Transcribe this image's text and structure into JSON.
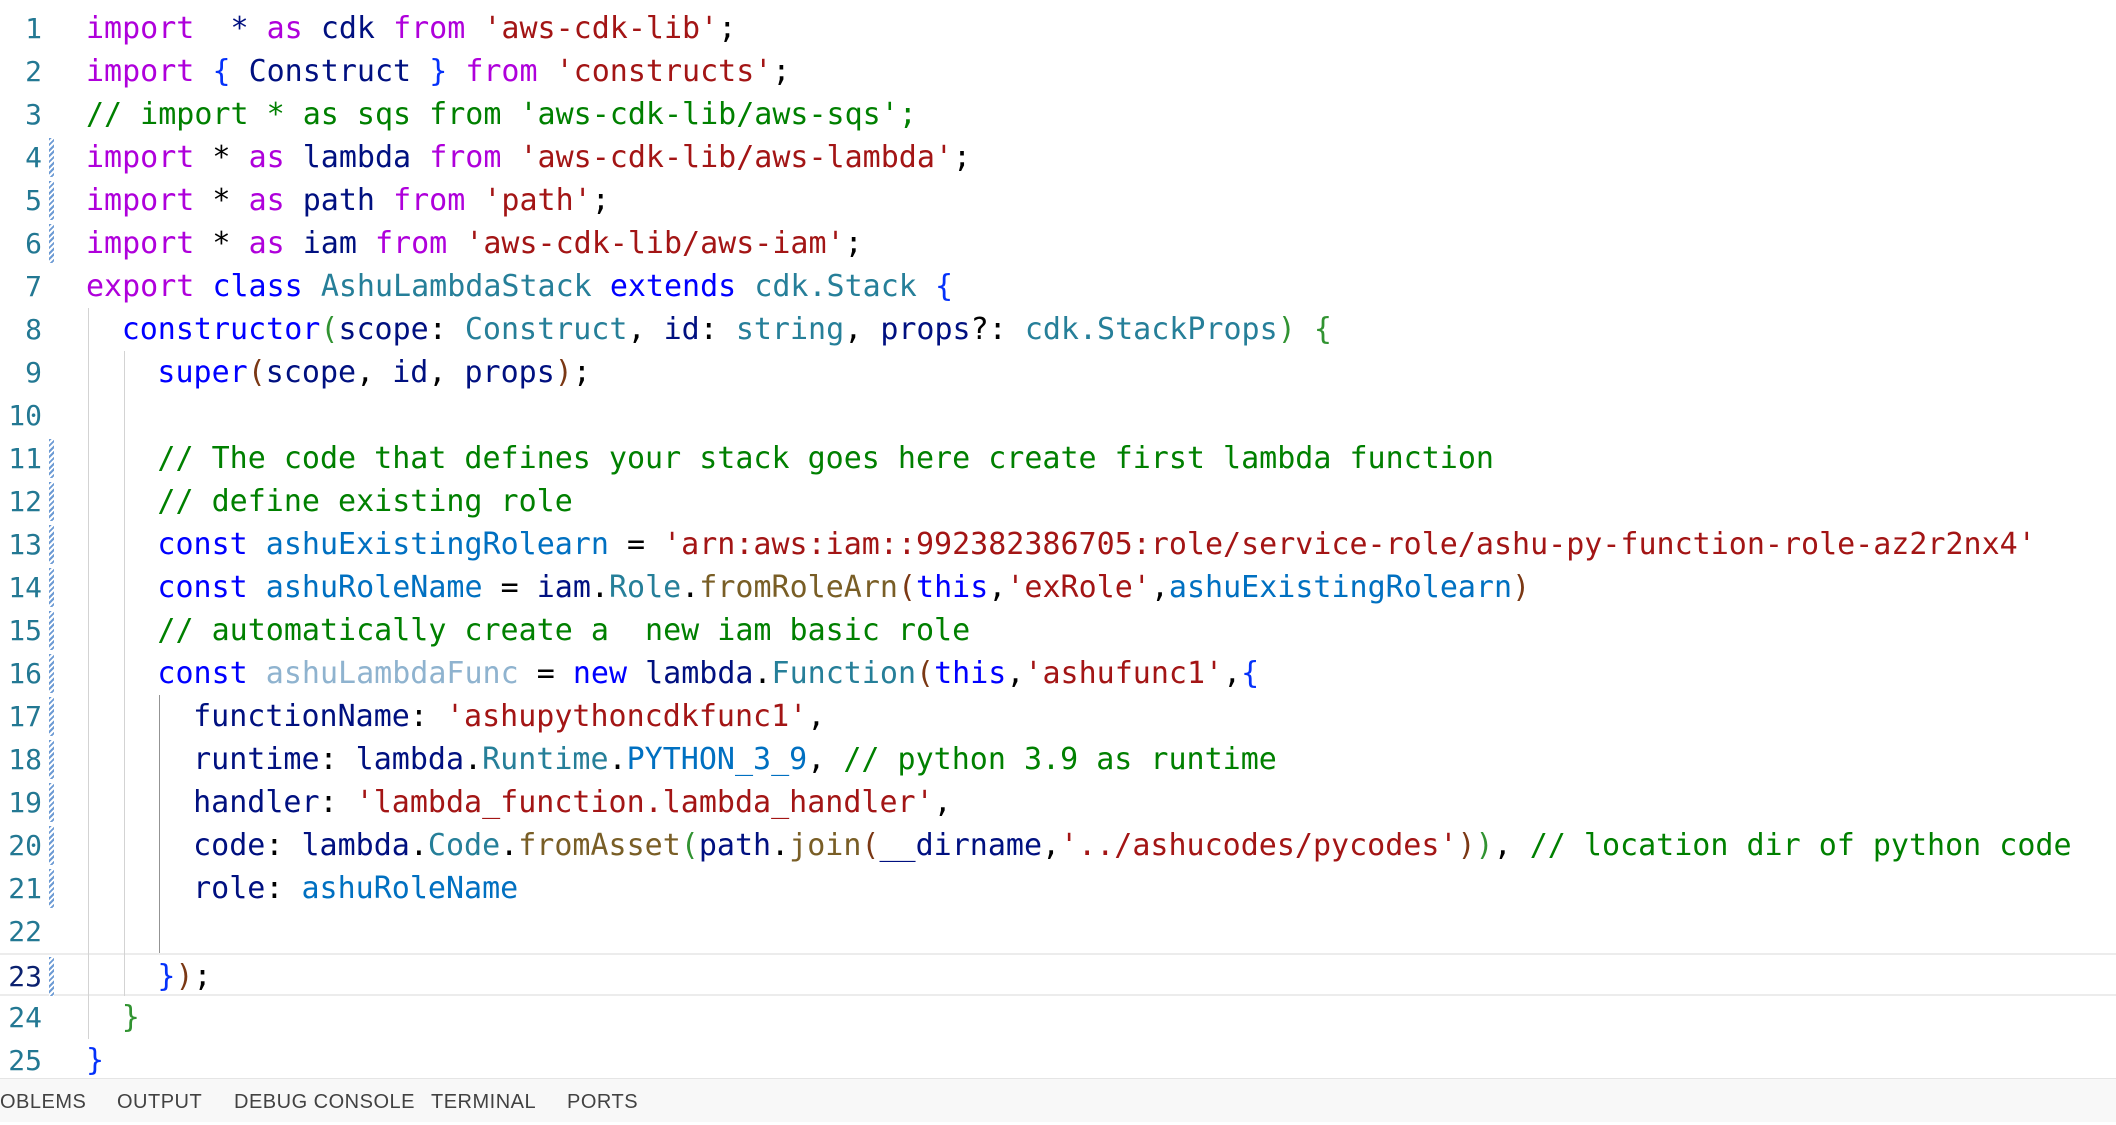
{
  "editor": {
    "line_numbers": [
      "1",
      "2",
      "3",
      "4",
      "5",
      "6",
      "7",
      "8",
      "9",
      "10",
      "11",
      "12",
      "13",
      "14",
      "15",
      "16",
      "17",
      "18",
      "19",
      "20",
      "21",
      "22",
      "23",
      "24",
      "25"
    ],
    "current_line": "23",
    "lines": [
      [
        [
          "kc",
          "import"
        ],
        [
          "",
          "  "
        ],
        [
          "var",
          "*"
        ],
        [
          "",
          " "
        ],
        [
          "kc",
          "as"
        ],
        [
          "",
          " "
        ],
        [
          "var",
          "cdk"
        ],
        [
          "",
          " "
        ],
        [
          "kc",
          "from"
        ],
        [
          "",
          " "
        ],
        [
          "str",
          "'aws-cdk-lib'"
        ],
        [
          "",
          ";"
        ]
      ],
      [
        [
          "kc",
          "import"
        ],
        [
          "",
          " "
        ],
        [
          "b1",
          "{"
        ],
        [
          "",
          " "
        ],
        [
          "var",
          "Construct"
        ],
        [
          "",
          " "
        ],
        [
          "b1",
          "}"
        ],
        [
          "",
          " "
        ],
        [
          "kc",
          "from"
        ],
        [
          "",
          " "
        ],
        [
          "str",
          "'constructs'"
        ],
        [
          "",
          ";"
        ]
      ],
      [
        [
          "cm",
          "// import * as sqs from 'aws-cdk-lib/aws-sqs';"
        ]
      ],
      [
        [
          "kc",
          "import"
        ],
        [
          "",
          " * "
        ],
        [
          "kc",
          "as"
        ],
        [
          "",
          " "
        ],
        [
          "var",
          "lambda"
        ],
        [
          "",
          " "
        ],
        [
          "kc",
          "from"
        ],
        [
          "",
          " "
        ],
        [
          "str",
          "'aws-cdk-lib/aws-lambda'"
        ],
        [
          "",
          ";"
        ]
      ],
      [
        [
          "kc",
          "import"
        ],
        [
          "",
          " * "
        ],
        [
          "kc",
          "as"
        ],
        [
          "",
          " "
        ],
        [
          "var",
          "path"
        ],
        [
          "",
          " "
        ],
        [
          "kc",
          "from"
        ],
        [
          "",
          " "
        ],
        [
          "str",
          "'path'"
        ],
        [
          "",
          ";"
        ]
      ],
      [
        [
          "kc",
          "import"
        ],
        [
          "",
          " * "
        ],
        [
          "kc",
          "as"
        ],
        [
          "",
          " "
        ],
        [
          "var",
          "iam"
        ],
        [
          "",
          " "
        ],
        [
          "kc",
          "from"
        ],
        [
          "",
          " "
        ],
        [
          "str",
          "'aws-cdk-lib/aws-iam'"
        ],
        [
          "",
          ";"
        ]
      ],
      [
        [
          "kc",
          "export"
        ],
        [
          "",
          " "
        ],
        [
          "kw",
          "class"
        ],
        [
          "",
          " "
        ],
        [
          "ty",
          "AshuLambdaStack"
        ],
        [
          "",
          " "
        ],
        [
          "kw",
          "extends"
        ],
        [
          "",
          " "
        ],
        [
          "ty",
          "cdk.Stack"
        ],
        [
          "",
          " "
        ],
        [
          "b1",
          "{"
        ]
      ],
      [
        [
          "",
          ""
        ],
        [
          "kw",
          "constructor"
        ],
        [
          "b2",
          "("
        ],
        [
          "var",
          "scope"
        ],
        [
          "",
          ": "
        ],
        [
          "ty",
          "Construct"
        ],
        [
          "",
          ", "
        ],
        [
          "var",
          "id"
        ],
        [
          "",
          ": "
        ],
        [
          "ty",
          "string"
        ],
        [
          "",
          ", "
        ],
        [
          "var",
          "props"
        ],
        [
          "",
          "?: "
        ],
        [
          "ty",
          "cdk.StackProps"
        ],
        [
          "b2",
          ")"
        ],
        [
          "",
          " "
        ],
        [
          "b2",
          "{"
        ]
      ],
      [
        [
          "kw",
          "super"
        ],
        [
          "b3",
          "("
        ],
        [
          "var",
          "scope"
        ],
        [
          "",
          ", "
        ],
        [
          "var",
          "id"
        ],
        [
          "",
          ", "
        ],
        [
          "var",
          "props"
        ],
        [
          "b3",
          ")"
        ],
        [
          "",
          ";"
        ]
      ],
      [],
      [
        [
          "cm",
          "// The code that defines your stack goes here create first lambda function"
        ]
      ],
      [
        [
          "cm",
          "// define existing role"
        ]
      ],
      [
        [
          "kw",
          "const"
        ],
        [
          "",
          " "
        ],
        [
          "cst",
          "ashuExistingRolearn"
        ],
        [
          "",
          " = "
        ],
        [
          "str",
          "'arn:aws:iam::992382386705:role/service-role/ashu-py-function-role-az2r2nx4'"
        ]
      ],
      [
        [
          "kw",
          "const"
        ],
        [
          "",
          " "
        ],
        [
          "cst",
          "ashuRoleName"
        ],
        [
          "",
          " = "
        ],
        [
          "var",
          "iam"
        ],
        [
          "",
          "."
        ],
        [
          "ty",
          "Role"
        ],
        [
          "",
          "."
        ],
        [
          "fn",
          "fromRoleArn"
        ],
        [
          "b3",
          "("
        ],
        [
          "kw",
          "this"
        ],
        [
          "",
          ","
        ],
        [
          "str",
          "'exRole'"
        ],
        [
          "",
          ","
        ],
        [
          "cst",
          "ashuExistingRolearn"
        ],
        [
          "b3",
          ")"
        ]
      ],
      [
        [
          "cm",
          "// automatically create a  new iam basic role"
        ]
      ],
      [
        [
          "kw",
          "const"
        ],
        [
          "",
          " "
        ],
        [
          "dim",
          "ashuLambdaFunc"
        ],
        [
          "",
          " = "
        ],
        [
          "kw",
          "new"
        ],
        [
          "",
          " "
        ],
        [
          "var",
          "lambda"
        ],
        [
          "",
          "."
        ],
        [
          "ty",
          "Function"
        ],
        [
          "b3",
          "("
        ],
        [
          "kw",
          "this"
        ],
        [
          "",
          ","
        ],
        [
          "str",
          "'ashufunc1'"
        ],
        [
          "",
          ","
        ],
        [
          "b1",
          "{"
        ]
      ],
      [
        [
          "var",
          "functionName"
        ],
        [
          "",
          ": "
        ],
        [
          "str",
          "'ashupythoncdkfunc1'"
        ],
        [
          "",
          ","
        ]
      ],
      [
        [
          "var",
          "runtime"
        ],
        [
          "",
          ": "
        ],
        [
          "var",
          "lambda"
        ],
        [
          "",
          "."
        ],
        [
          "ty",
          "Runtime"
        ],
        [
          "",
          "."
        ],
        [
          "cst",
          "PYTHON_3_9"
        ],
        [
          "",
          ", "
        ],
        [
          "cm",
          "// python 3.9 as runtime"
        ]
      ],
      [
        [
          "var",
          "handler"
        ],
        [
          "",
          ": "
        ],
        [
          "str",
          "'lambda_function.lambda_handler'"
        ],
        [
          "",
          ","
        ]
      ],
      [
        [
          "var",
          "code"
        ],
        [
          "",
          ": "
        ],
        [
          "var",
          "lambda"
        ],
        [
          "",
          "."
        ],
        [
          "ty",
          "Code"
        ],
        [
          "",
          "."
        ],
        [
          "fn",
          "fromAsset"
        ],
        [
          "b2",
          "("
        ],
        [
          "var",
          "path"
        ],
        [
          "",
          "."
        ],
        [
          "fn",
          "join"
        ],
        [
          "b3",
          "("
        ],
        [
          "var",
          "__dirname"
        ],
        [
          "",
          ","
        ],
        [
          "str",
          "'../ashucodes/pycodes'"
        ],
        [
          "b3",
          ")"
        ],
        [
          "b2",
          ")"
        ],
        [
          "",
          ", "
        ],
        [
          "cm",
          "// location dir of python code"
        ]
      ],
      [
        [
          "var",
          "role"
        ],
        [
          "",
          ": "
        ],
        [
          "cst",
          "ashuRoleName"
        ]
      ],
      [],
      [
        [
          "b1",
          "}"
        ],
        [
          "b3",
          ")"
        ],
        [
          "",
          ";"
        ]
      ],
      [
        [
          "b2",
          "}"
        ]
      ],
      [
        [
          "b1",
          "}"
        ]
      ]
    ]
  },
  "panel": {
    "tabs": [
      "OBLEMS",
      "OUTPUT",
      "DEBUG CONSOLE",
      "TERMINAL",
      "PORTS"
    ]
  }
}
